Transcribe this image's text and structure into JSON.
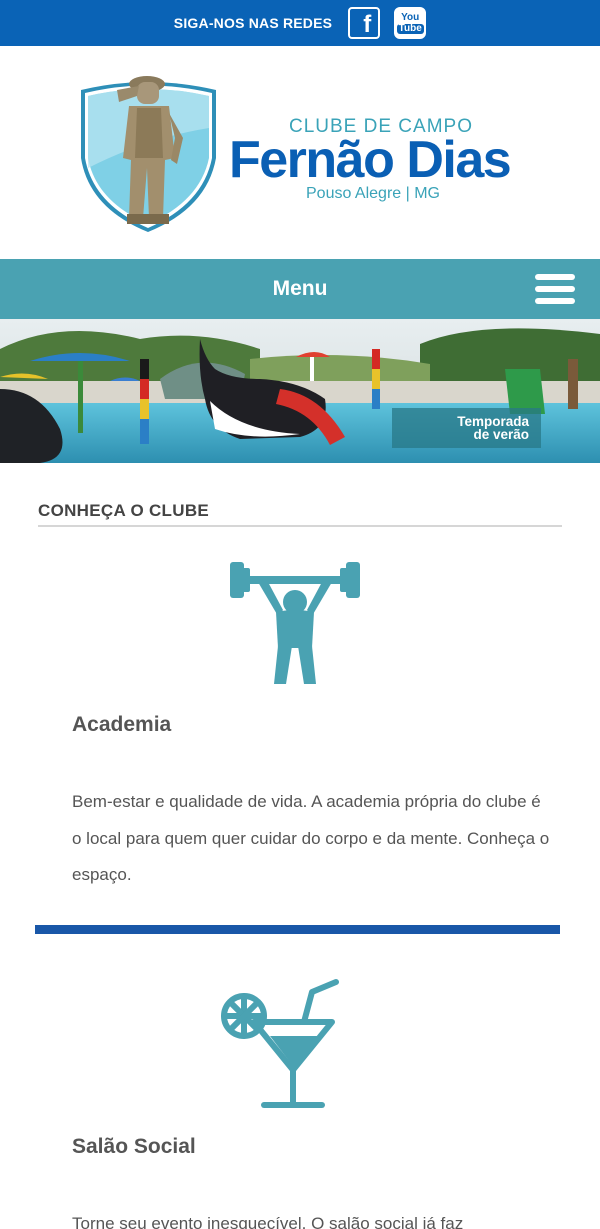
{
  "topbar": {
    "follow_label": "SIGA-NOS NAS REDES",
    "facebook_icon": "facebook-icon",
    "youtube_icon": "youtube-icon",
    "youtube_you": "You",
    "youtube_tube": "Tube",
    "color": "#0a63b6"
  },
  "logo": {
    "line1": "CLUBE DE CAMPO",
    "line2": "Fernão Dias",
    "line3": "Pouso Alegre | MG",
    "accent": "#3aa3b8",
    "brand": "#0a5fb4"
  },
  "menu": {
    "label": "Menu",
    "icon": "hamburger-icon",
    "color": "#4aa2b2"
  },
  "banner": {
    "season_label_line1": "Temporada",
    "season_label_line2": "de verão"
  },
  "section": {
    "title": "CONHEÇA O CLUBE"
  },
  "cards": [
    {
      "icon": "weightlifter-icon",
      "title": "Academia",
      "text": "Bem-estar e qualidade de vida. A academia própria do clube é o local para quem quer cuidar do corpo e da mente. Conheça o espaço."
    },
    {
      "icon": "cocktail-icon",
      "title": "Salão Social",
      "text": "Torne seu evento inesquecível. O salão social já faz"
    }
  ],
  "icon_color": "#4aa2b2",
  "divider_color": "#1957a8"
}
